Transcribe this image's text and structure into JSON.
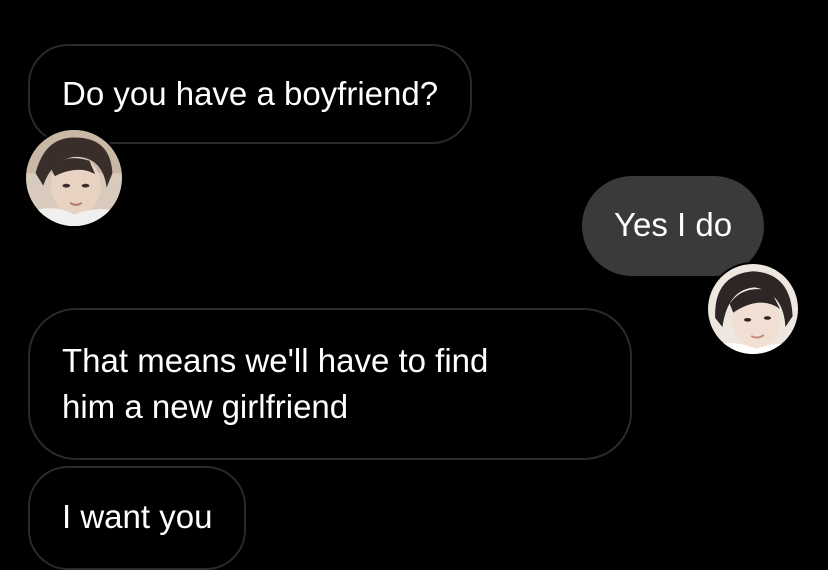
{
  "messages": [
    {
      "sender": "other",
      "text": "Do you have a boyfriend?"
    },
    {
      "sender": "me",
      "text": "Yes I do"
    },
    {
      "sender": "other",
      "lines": [
        "That means we'll have to find",
        "him a new girlfriend"
      ]
    },
    {
      "sender": "other",
      "text": "I want you"
    }
  ],
  "colors": {
    "background": "#000000",
    "incoming_border": "#2a2a2a",
    "outgoing_fill": "#3a3a3a",
    "text": "#ffffff"
  },
  "avatars": {
    "other": "profile-photo-icon",
    "me": "profile-photo-icon"
  }
}
